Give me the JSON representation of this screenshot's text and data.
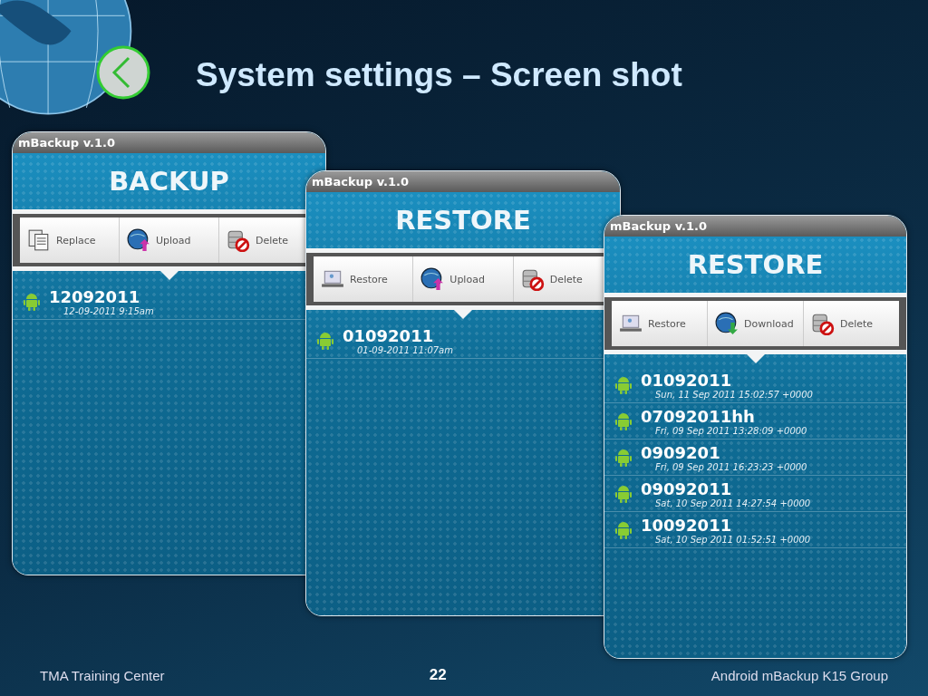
{
  "slide": {
    "title": "System settings – Screen shot"
  },
  "screens": [
    {
      "app_title": "mBackup v.1.0",
      "heading": "BACKUP",
      "actions": [
        {
          "kind": "copy",
          "label": "Replace"
        },
        {
          "kind": "upload",
          "label": "Upload"
        },
        {
          "kind": "delete",
          "label": "Delete"
        }
      ],
      "items": [
        {
          "name": "12092011",
          "date": "12-09-2011 9:15am"
        }
      ]
    },
    {
      "app_title": "mBackup v.1.0",
      "heading": "RESTORE",
      "actions": [
        {
          "kind": "restore",
          "label": "Restore"
        },
        {
          "kind": "upload",
          "label": "Upload"
        },
        {
          "kind": "delete",
          "label": "Delete"
        }
      ],
      "items": [
        {
          "name": "01092011",
          "date": "01-09-2011 11:07am"
        }
      ]
    },
    {
      "app_title": "mBackup v.1.0",
      "heading": "RESTORE",
      "actions": [
        {
          "kind": "restore",
          "label": "Restore"
        },
        {
          "kind": "download",
          "label": "Download"
        },
        {
          "kind": "delete",
          "label": "Delete"
        }
      ],
      "items": [
        {
          "name": "01092011",
          "date": "Sun, 11 Sep 2011 15:02:57 +0000"
        },
        {
          "name": "07092011hh",
          "date": "Fri, 09 Sep 2011 13:28:09 +0000"
        },
        {
          "name": "0909201",
          "date": "Fri, 09 Sep 2011 16:23:23 +0000"
        },
        {
          "name": "09092011",
          "date": "Sat, 10 Sep 2011 14:27:54 +0000"
        },
        {
          "name": "10092011",
          "date": "Sat, 10 Sep 2011 01:52:51 +0000"
        }
      ]
    }
  ],
  "footer": {
    "left": "TMA Training Center",
    "page": "22",
    "right": "Android mBackup K15 Group"
  }
}
